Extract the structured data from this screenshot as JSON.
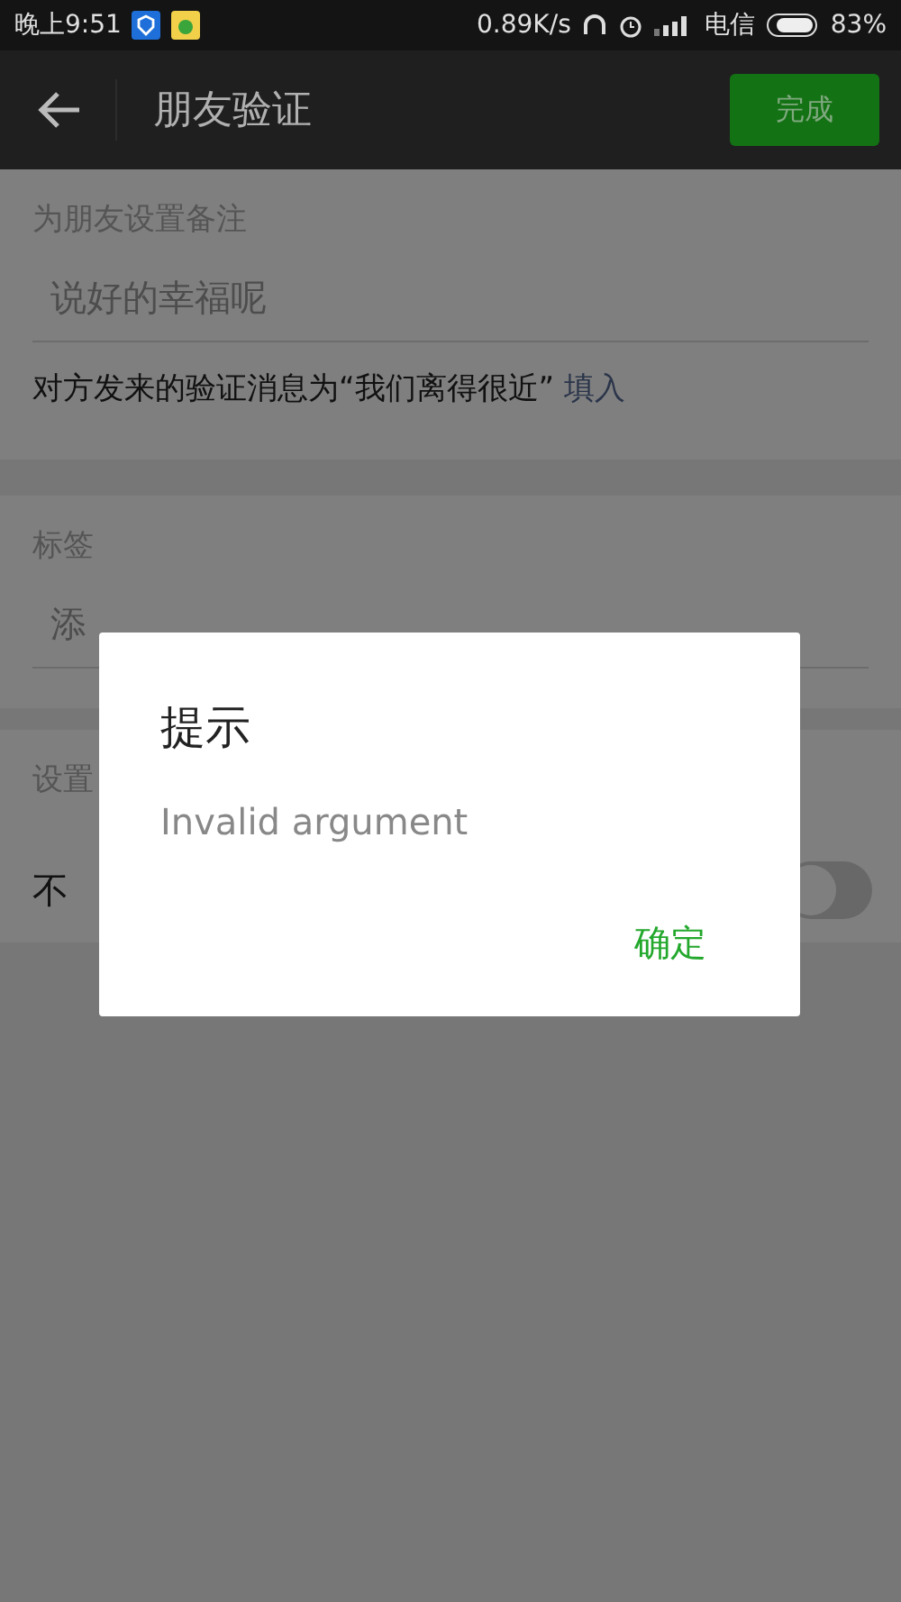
{
  "status_bar": {
    "time": "晚上9:51",
    "speed": "0.89K/s",
    "carrier": "电信",
    "battery": "83%"
  },
  "app_bar": {
    "title": "朋友验证",
    "done_button": "完成"
  },
  "remark": {
    "label": "为朋友设置备注",
    "placeholder": "说好的幸福呢",
    "message": "对方发来的验证消息为“我们离得很近”",
    "fill_link": "填入"
  },
  "tags": {
    "label": "标签",
    "placeholder": "添"
  },
  "privacy": {
    "label": "设置",
    "row_label": "不",
    "on": false
  },
  "dialog": {
    "title": "提示",
    "message": "Invalid argument",
    "ok_button": "确定"
  }
}
